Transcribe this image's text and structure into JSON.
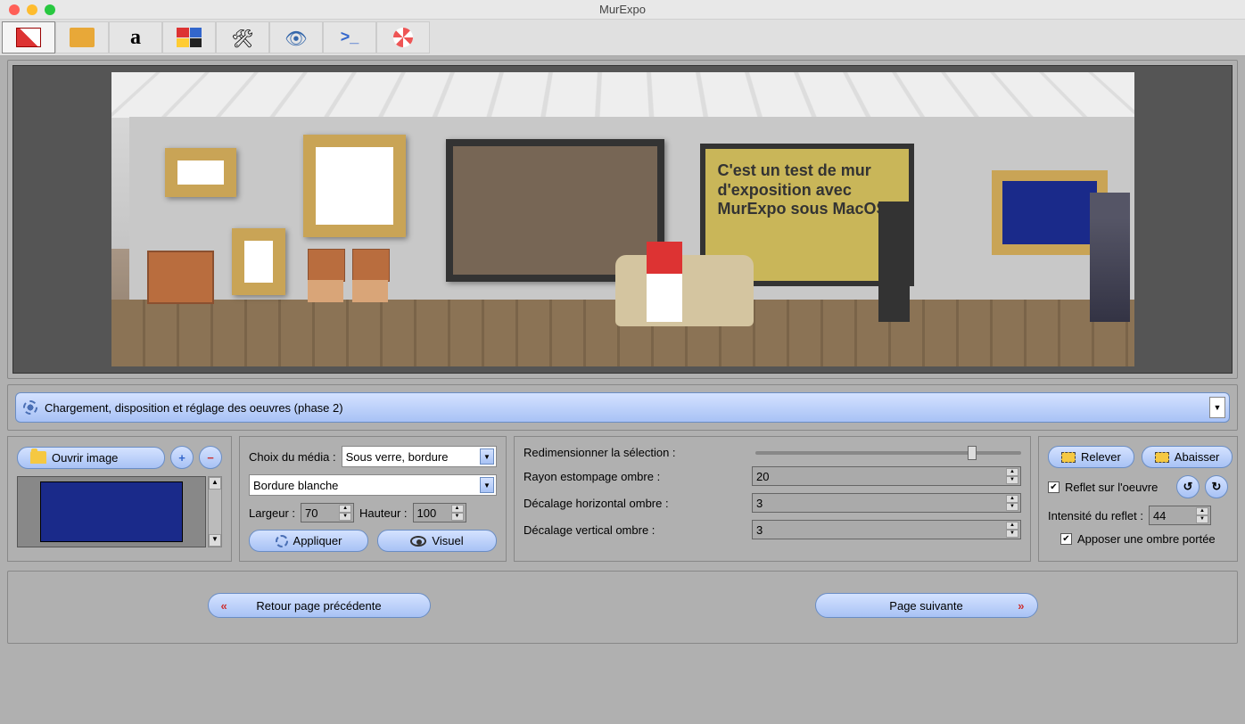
{
  "app": {
    "title": "MurExpo"
  },
  "phase": {
    "label": "Chargement, disposition et réglage des oeuvres (phase 2)"
  },
  "scene": {
    "text_frame": "C'est un test de mur d'exposition avec MurExpo sous MacOS"
  },
  "image_panel": {
    "open_label": "Ouvrir image"
  },
  "media_panel": {
    "choix_label": "Choix du média :",
    "choix_value": "Sous verre, bordure",
    "bordure_value": "Bordure blanche",
    "largeur_label": "Largeur :",
    "largeur_value": "70",
    "hauteur_label": "Hauteur :",
    "hauteur_value": "100",
    "appliquer_label": "Appliquer",
    "visuel_label": "Visuel"
  },
  "shadow_panel": {
    "resize_label": "Redimensionner la sélection :",
    "resize_pos_pct": 80,
    "rayon_label": "Rayon estompage ombre :",
    "rayon_value": "20",
    "dh_label": "Décalage horizontal ombre :",
    "dh_value": "3",
    "dv_label": "Décalage vertical ombre :",
    "dv_value": "3"
  },
  "reflect_panel": {
    "relever_label": "Relever",
    "abaisser_label": "Abaisser",
    "reflet_check_label": "Reflet sur l'oeuvre",
    "intensite_label": "Intensité du reflet :",
    "intensite_value": "44",
    "ombre_check_label": "Apposer une ombre portée"
  },
  "nav": {
    "prev_label": "Retour page précédente",
    "next_label": "Page suivante"
  }
}
